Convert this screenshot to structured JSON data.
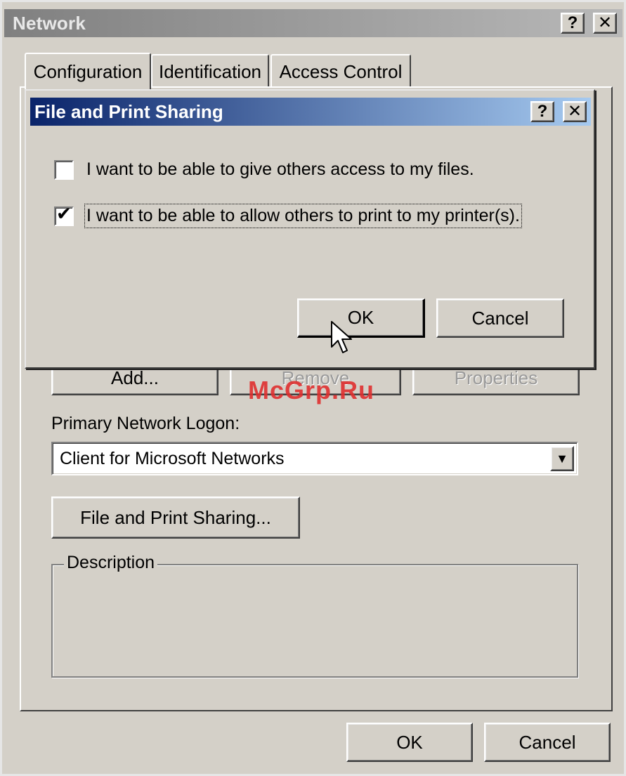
{
  "main_window": {
    "title": "Network",
    "help_glyph": "?",
    "close_glyph": "✕"
  },
  "tabs": [
    {
      "label": "Configuration",
      "active": true
    },
    {
      "label": "Identification",
      "active": false
    },
    {
      "label": "Access Control",
      "active": false
    }
  ],
  "component_buttons": {
    "add": "Add...",
    "remove": "Remove",
    "properties": "Properties"
  },
  "primary_logon": {
    "label": "Primary Network Logon:",
    "value": "Client for Microsoft Networks",
    "arrow_glyph": "▼"
  },
  "file_print_button": "File and Print Sharing...",
  "description": {
    "label": "Description"
  },
  "footer": {
    "ok": "OK",
    "cancel": "Cancel"
  },
  "dialog": {
    "title": "File and Print Sharing",
    "help_glyph": "?",
    "close_glyph": "✕",
    "options": [
      {
        "label": "I want to be able to give others access to my files.",
        "checked": false
      },
      {
        "label": "I want to be able to allow others to print to my printer(s).",
        "checked": true
      }
    ],
    "checkmark_glyph": "✔",
    "ok": "OK",
    "cancel": "Cancel"
  },
  "watermark": "McGrp.Ru",
  "icons": {
    "cursor": "arrow-cursor-icon",
    "checkmark": "checkmark-icon",
    "dropdown": "chevron-down-icon"
  }
}
